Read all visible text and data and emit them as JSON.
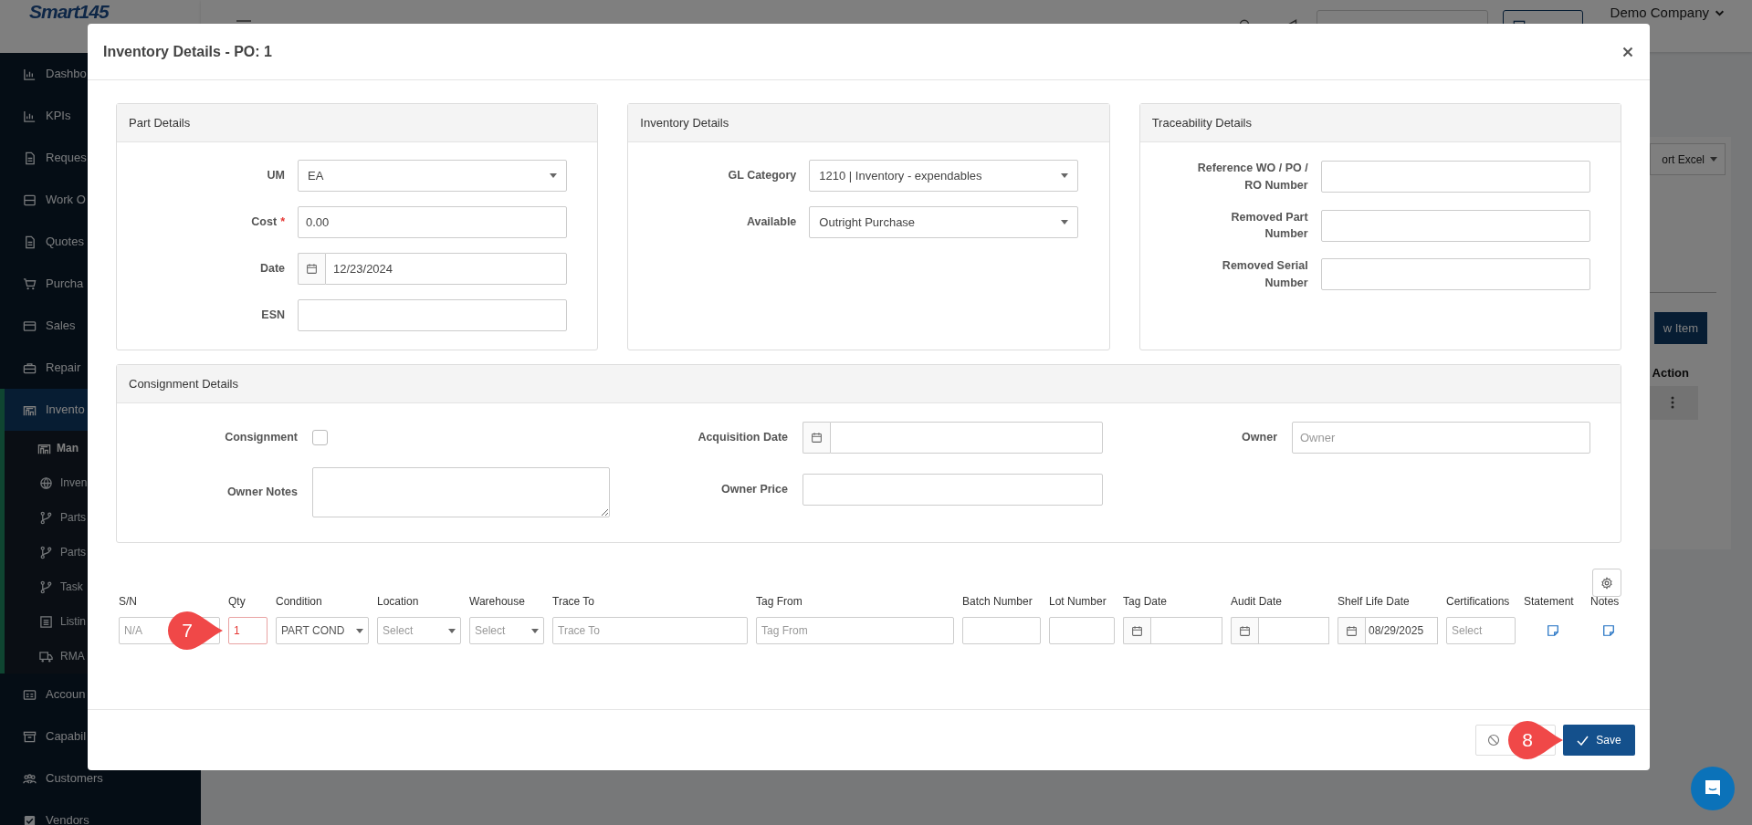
{
  "sidebar": {
    "logo": "Smart145",
    "items": [
      {
        "label": "Dashbo",
        "selected": false
      },
      {
        "label": "KPIs",
        "selected": false
      },
      {
        "label": "Reques",
        "selected": false
      },
      {
        "label": "Work O",
        "selected": false
      },
      {
        "label": "Quotes",
        "selected": false
      },
      {
        "label": "Purcha",
        "selected": false
      },
      {
        "label": "Sales",
        "selected": false
      },
      {
        "label": "Repair",
        "selected": false
      },
      {
        "label": "Invento",
        "selected": true,
        "children": [
          {
            "label": "Man",
            "selected": true
          },
          {
            "label": "Inven",
            "selected": false
          },
          {
            "label": "Parts",
            "selected": false
          },
          {
            "label": "Parts",
            "selected": false
          },
          {
            "label": "Task",
            "selected": false
          },
          {
            "label": "Listin",
            "selected": false
          },
          {
            "label": "RMA",
            "selected": false
          }
        ]
      },
      {
        "label": "Accoun",
        "selected": false
      },
      {
        "label": "Capabil",
        "selected": false
      },
      {
        "label": "Customers",
        "selected": false
      },
      {
        "label": "Vendors",
        "selected": false
      }
    ]
  },
  "top_bar": {
    "company": "Demo Company"
  },
  "background": {
    "export_button": "ort Excel",
    "new_item_button": "w Item",
    "action_header": "Action"
  },
  "modal": {
    "title": "Inventory Details - PO: 1",
    "sections": [
      {
        "title": "Part Details",
        "fields": [
          {
            "label": "UM",
            "kind": "select",
            "value": "EA"
          },
          {
            "label": "Cost",
            "kind": "text",
            "value": "0.00",
            "required_mark": "*"
          },
          {
            "label": "Date",
            "kind": "date",
            "value": "12/23/2024"
          },
          {
            "label": "ESN",
            "kind": "text"
          }
        ]
      },
      {
        "title": "Inventory Details",
        "fields": [
          {
            "label": "GL Category",
            "kind": "select",
            "value": "1210 | Inventory - expendables"
          },
          {
            "label": "Available",
            "kind": "select",
            "value": "Outright Purchase"
          }
        ]
      },
      {
        "title": "Traceability Details",
        "fields": [
          {
            "label": "Reference WO / PO / RO Number",
            "kind": "text"
          },
          {
            "label": "Removed Part Number",
            "kind": "text"
          },
          {
            "label": "Removed Serial Number",
            "kind": "text"
          }
        ]
      }
    ],
    "consignment": {
      "title": "Consignment Details",
      "consignment_label": "Consignment",
      "consignment_checked": false,
      "owner_notes_label": "Owner Notes",
      "acquisition_date_label": "Acquisition Date",
      "owner_price_label": "Owner Price",
      "owner_label": "Owner",
      "owner_placeholder": "Owner"
    },
    "items_table": {
      "columns": [
        "S/N",
        "Qty",
        "Condition",
        "Location",
        "Warehouse",
        "Trace To",
        "Tag From",
        "Batch Number",
        "Lot Number",
        "Tag Date",
        "Audit Date",
        "Shelf Life Date",
        "Certifications",
        "Statement",
        "Notes"
      ],
      "cells": [
        {
          "kind": "text",
          "placeholder": "N/A",
          "invalid": false
        },
        {
          "kind": "text",
          "value": "1",
          "invalid": true
        },
        {
          "kind": "select",
          "value": "PART COND",
          "invalid": false
        },
        {
          "kind": "select",
          "placeholder": "Select",
          "invalid": false
        },
        {
          "kind": "select",
          "placeholder": "Select",
          "invalid": false
        },
        {
          "kind": "text",
          "placeholder": "Trace To",
          "invalid": false
        },
        {
          "kind": "text",
          "placeholder": "Tag From",
          "invalid": false
        },
        {
          "kind": "text",
          "invalid": false
        },
        {
          "kind": "text",
          "invalid": false
        },
        {
          "kind": "date",
          "invalid": false
        },
        {
          "kind": "date",
          "invalid": false
        },
        {
          "kind": "date",
          "value": "08/29/2025",
          "invalid": false
        },
        {
          "kind": "text",
          "placeholder": "Select",
          "invalid": false
        },
        {
          "kind": "note",
          "invalid": false
        },
        {
          "kind": "note",
          "invalid": false
        }
      ]
    },
    "save_button": "Save"
  },
  "callouts": [
    {
      "label": "7"
    },
    {
      "label": "8"
    }
  ]
}
